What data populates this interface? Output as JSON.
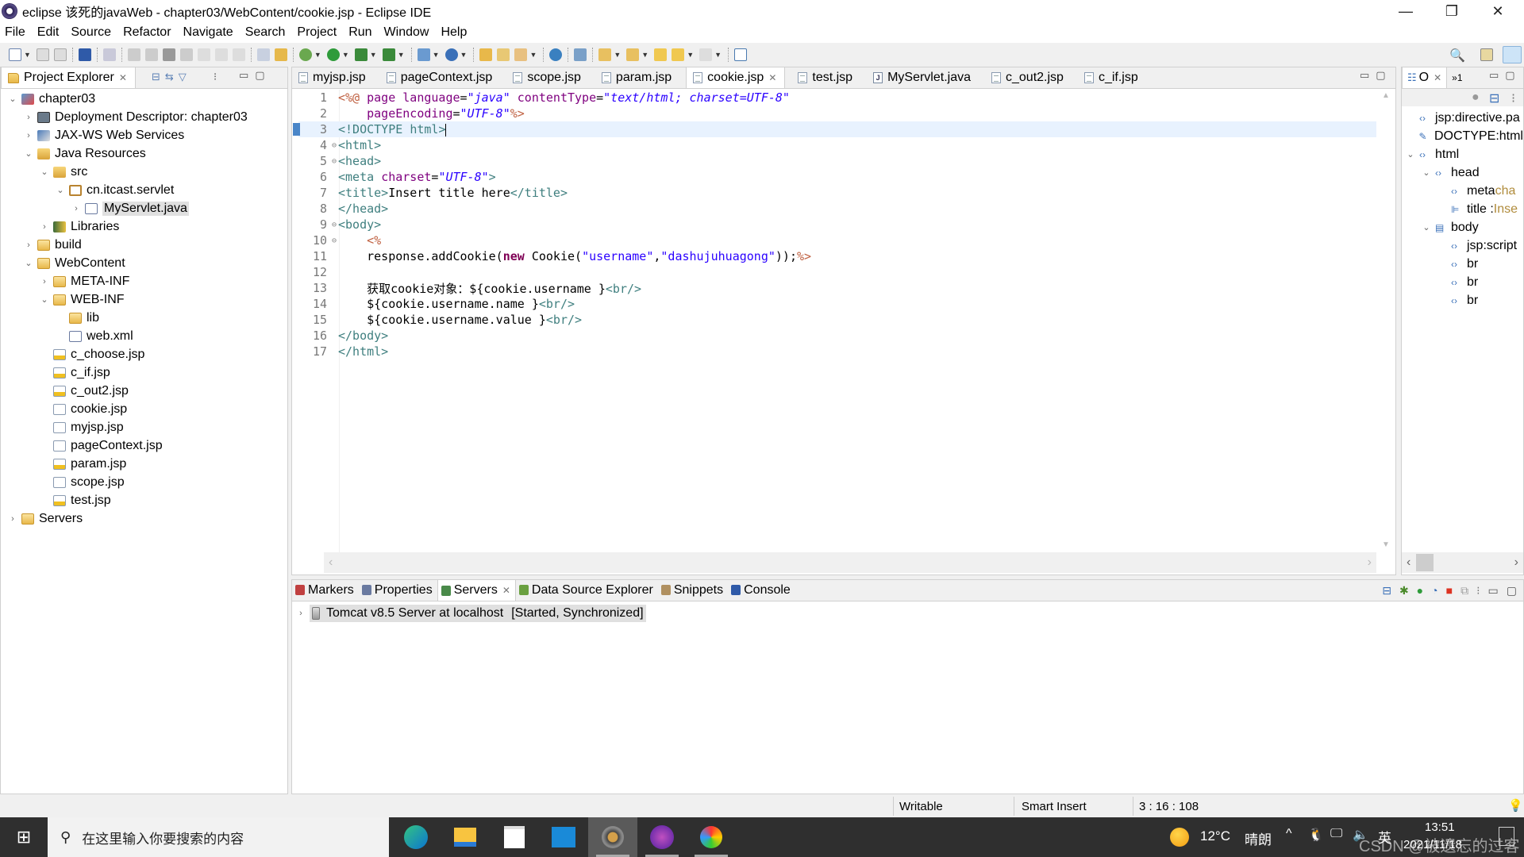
{
  "window": {
    "title": "eclipse 该死的javaWeb - chapter03/WebContent/cookie.jsp - Eclipse IDE",
    "controls": {
      "minimize": "—",
      "restore": "❐",
      "close": "✕"
    }
  },
  "menu": [
    "File",
    "Edit",
    "Source",
    "Refactor",
    "Navigate",
    "Search",
    "Project",
    "Run",
    "Window",
    "Help"
  ],
  "project_explorer": {
    "title": "Project Explorer",
    "close": "✕",
    "tree": [
      {
        "label": "chapter03",
        "depth": 0,
        "toggle": "⌄",
        "icon": "web-project-icon"
      },
      {
        "label": "Deployment Descriptor: chapter03",
        "depth": 1,
        "toggle": "›",
        "icon": "deployment-descriptor-icon"
      },
      {
        "label": "JAX-WS Web Services",
        "depth": 1,
        "toggle": "›",
        "icon": "web-services-icon"
      },
      {
        "label": "Java Resources",
        "depth": 1,
        "toggle": "⌄",
        "icon": "java-resources-icon"
      },
      {
        "label": "src",
        "depth": 2,
        "toggle": "⌄",
        "icon": "source-folder-icon"
      },
      {
        "label": "cn.itcast.servlet",
        "depth": 3,
        "toggle": "⌄",
        "icon": "package-icon"
      },
      {
        "label": "MyServlet.java",
        "depth": 4,
        "toggle": "›",
        "icon": "java-file-icon",
        "selected": true
      },
      {
        "label": "Libraries",
        "depth": 2,
        "toggle": "›",
        "icon": "libraries-icon"
      },
      {
        "label": "build",
        "depth": 1,
        "toggle": "›",
        "icon": "folder-icon"
      },
      {
        "label": "WebContent",
        "depth": 1,
        "toggle": "⌄",
        "icon": "folder-icon"
      },
      {
        "label": "META-INF",
        "depth": 2,
        "toggle": "›",
        "icon": "folder-icon"
      },
      {
        "label": "WEB-INF",
        "depth": 2,
        "toggle": "⌄",
        "icon": "folder-icon"
      },
      {
        "label": "lib",
        "depth": 3,
        "toggle": "",
        "icon": "folder-icon"
      },
      {
        "label": "web.xml",
        "depth": 3,
        "toggle": "",
        "icon": "xml-file-icon"
      },
      {
        "label": "c_choose.jsp",
        "depth": 2,
        "toggle": "",
        "icon": "jsp-warning-file-icon"
      },
      {
        "label": "c_if.jsp",
        "depth": 2,
        "toggle": "",
        "icon": "jsp-warning-file-icon"
      },
      {
        "label": "c_out2.jsp",
        "depth": 2,
        "toggle": "",
        "icon": "jsp-warning-file-icon"
      },
      {
        "label": "cookie.jsp",
        "depth": 2,
        "toggle": "",
        "icon": "jsp-file-icon"
      },
      {
        "label": "myjsp.jsp",
        "depth": 2,
        "toggle": "",
        "icon": "jsp-file-icon"
      },
      {
        "label": "pageContext.jsp",
        "depth": 2,
        "toggle": "",
        "icon": "jsp-file-icon"
      },
      {
        "label": "param.jsp",
        "depth": 2,
        "toggle": "",
        "icon": "jsp-warning-file-icon"
      },
      {
        "label": "scope.jsp",
        "depth": 2,
        "toggle": "",
        "icon": "jsp-file-icon"
      },
      {
        "label": "test.jsp",
        "depth": 2,
        "toggle": "",
        "icon": "jsp-warning-file-icon"
      },
      {
        "label": "Servers",
        "depth": 0,
        "toggle": "›",
        "icon": "folder-icon"
      }
    ]
  },
  "editor": {
    "tabs": [
      {
        "label": "myjsp.jsp",
        "type": "jsp"
      },
      {
        "label": "pageContext.jsp",
        "type": "jsp"
      },
      {
        "label": "scope.jsp",
        "type": "jsp"
      },
      {
        "label": "param.jsp",
        "type": "jsp"
      },
      {
        "label": "cookie.jsp",
        "type": "jsp",
        "active": true
      },
      {
        "label": "test.jsp",
        "type": "jsp"
      },
      {
        "label": "MyServlet.java",
        "type": "java"
      },
      {
        "label": "c_out2.jsp",
        "type": "jsp"
      },
      {
        "label": "c_if.jsp",
        "type": "jsp"
      }
    ],
    "close": "✕",
    "lines": [
      {
        "n": "1",
        "segs": [
          [
            "jsp",
            "<%@ "
          ],
          [
            "attr",
            "page "
          ],
          [
            "attr",
            "language"
          ],
          [
            "txt",
            "="
          ],
          [
            "val",
            "\"java\""
          ],
          [
            "txt",
            " "
          ],
          [
            "attr",
            "contentType"
          ],
          [
            "txt",
            "="
          ],
          [
            "val",
            "\"text/html; charset=UTF-8\""
          ]
        ]
      },
      {
        "n": "2",
        "segs": [
          [
            "txt",
            "    "
          ],
          [
            "attr",
            "pageEncoding"
          ],
          [
            "txt",
            "="
          ],
          [
            "val",
            "\"UTF-8\""
          ],
          [
            "jsp",
            "%>"
          ]
        ]
      },
      {
        "n": "3",
        "current": true,
        "segs": [
          [
            "tag",
            "<!DOCTYPE "
          ],
          [
            "tag",
            "html"
          ],
          [
            "tag",
            ">"
          ]
        ]
      },
      {
        "n": "4",
        "fold": true,
        "segs": [
          [
            "tag",
            "<html>"
          ]
        ]
      },
      {
        "n": "5",
        "fold": true,
        "segs": [
          [
            "tag",
            "<head>"
          ]
        ]
      },
      {
        "n": "6",
        "segs": [
          [
            "tag",
            "<meta "
          ],
          [
            "attr",
            "charset"
          ],
          [
            "txt",
            "="
          ],
          [
            "val",
            "\"UTF-8\""
          ],
          [
            "tag",
            ">"
          ]
        ]
      },
      {
        "n": "7",
        "segs": [
          [
            "tag",
            "<title>"
          ],
          [
            "txt",
            "Insert title here"
          ],
          [
            "tag",
            "</title>"
          ]
        ]
      },
      {
        "n": "8",
        "segs": [
          [
            "tag",
            "</head>"
          ]
        ]
      },
      {
        "n": "9",
        "fold": true,
        "segs": [
          [
            "tag",
            "<body>"
          ]
        ]
      },
      {
        "n": "10",
        "fold": true,
        "segs": [
          [
            "txt",
            "    "
          ],
          [
            "jsp",
            "<%"
          ]
        ]
      },
      {
        "n": "11",
        "segs": [
          [
            "txt",
            "    response.addCookie("
          ],
          [
            "kw",
            "new"
          ],
          [
            "txt",
            " Cookie("
          ],
          [
            "str",
            "\"username\""
          ],
          [
            "txt",
            ","
          ],
          [
            "str",
            "\"dashujuhuagong\""
          ],
          [
            "txt",
            "));"
          ],
          [
            "jsp",
            "%>"
          ]
        ]
      },
      {
        "n": "12",
        "segs": []
      },
      {
        "n": "13",
        "segs": [
          [
            "txt",
            "    获取cookie对象：${cookie.username }"
          ],
          [
            "tag",
            "<br/>"
          ]
        ]
      },
      {
        "n": "14",
        "segs": [
          [
            "txt",
            "    ${cookie.username.name }"
          ],
          [
            "tag",
            "<br/>"
          ]
        ]
      },
      {
        "n": "15",
        "segs": [
          [
            "txt",
            "    ${cookie.username.value }"
          ],
          [
            "tag",
            "<br/>"
          ]
        ]
      },
      {
        "n": "16",
        "segs": [
          [
            "tag",
            "</body>"
          ]
        ]
      },
      {
        "n": "17",
        "segs": [
          [
            "tag",
            "</html>"
          ]
        ]
      }
    ]
  },
  "outline": {
    "title": "O",
    "overflow": "»1",
    "tree": [
      {
        "label": "jsp:directive.pa",
        "depth": 0,
        "toggle": "",
        "icon": "element-icon"
      },
      {
        "label": "DOCTYPE:html",
        "depth": 0,
        "toggle": "",
        "icon": "doctype-icon"
      },
      {
        "label": "html",
        "depth": 0,
        "toggle": "⌄",
        "icon": "html-element-icon"
      },
      {
        "label": "head",
        "depth": 1,
        "toggle": "⌄",
        "icon": "element-icon"
      },
      {
        "label": "meta",
        "extra": " cha",
        "depth": 2,
        "toggle": "",
        "icon": "element-icon"
      },
      {
        "label": "title : ",
        "extra": "Inse",
        "depth": 2,
        "toggle": "",
        "icon": "title-element-icon"
      },
      {
        "label": "body",
        "depth": 1,
        "toggle": "⌄",
        "icon": "body-element-icon"
      },
      {
        "label": "jsp:script",
        "depth": 2,
        "toggle": "",
        "icon": "element-icon"
      },
      {
        "label": "br",
        "depth": 2,
        "toggle": "",
        "icon": "element-icon"
      },
      {
        "label": "br",
        "depth": 2,
        "toggle": "",
        "icon": "element-icon"
      },
      {
        "label": "br",
        "depth": 2,
        "toggle": "",
        "icon": "element-icon"
      }
    ]
  },
  "bottom_panel": {
    "tabs": [
      {
        "label": "Markers",
        "icon": "markers-icon"
      },
      {
        "label": "Properties",
        "icon": "properties-icon"
      },
      {
        "label": "Servers",
        "icon": "servers-icon",
        "active": true
      },
      {
        "label": "Data Source Explorer",
        "icon": "data-source-icon"
      },
      {
        "label": "Snippets",
        "icon": "snippets-icon"
      },
      {
        "label": "Console",
        "icon": "console-icon"
      }
    ],
    "server": {
      "name": "Tomcat v8.5 Server at localhost",
      "state": "[Started, Synchronized]"
    }
  },
  "status_bar": {
    "mode": "Writable",
    "insert": "Smart Insert",
    "position": "3 : 16 : 108"
  },
  "taskbar": {
    "search_placeholder": "在这里输入你要搜索的内容",
    "weather": {
      "temp": "12°C",
      "condition": "晴朗"
    },
    "time": "13:51",
    "date": "2021/11/18",
    "ime": "英",
    "watermark": "CSDN @被遗忘的过客"
  },
  "colors": {
    "accent": "#0078d7",
    "tag": "#3f7f7f",
    "attr": "#7f007f",
    "value": "#2a00ff",
    "jsp": "#bf5f3f",
    "keyword": "#7f0055"
  }
}
